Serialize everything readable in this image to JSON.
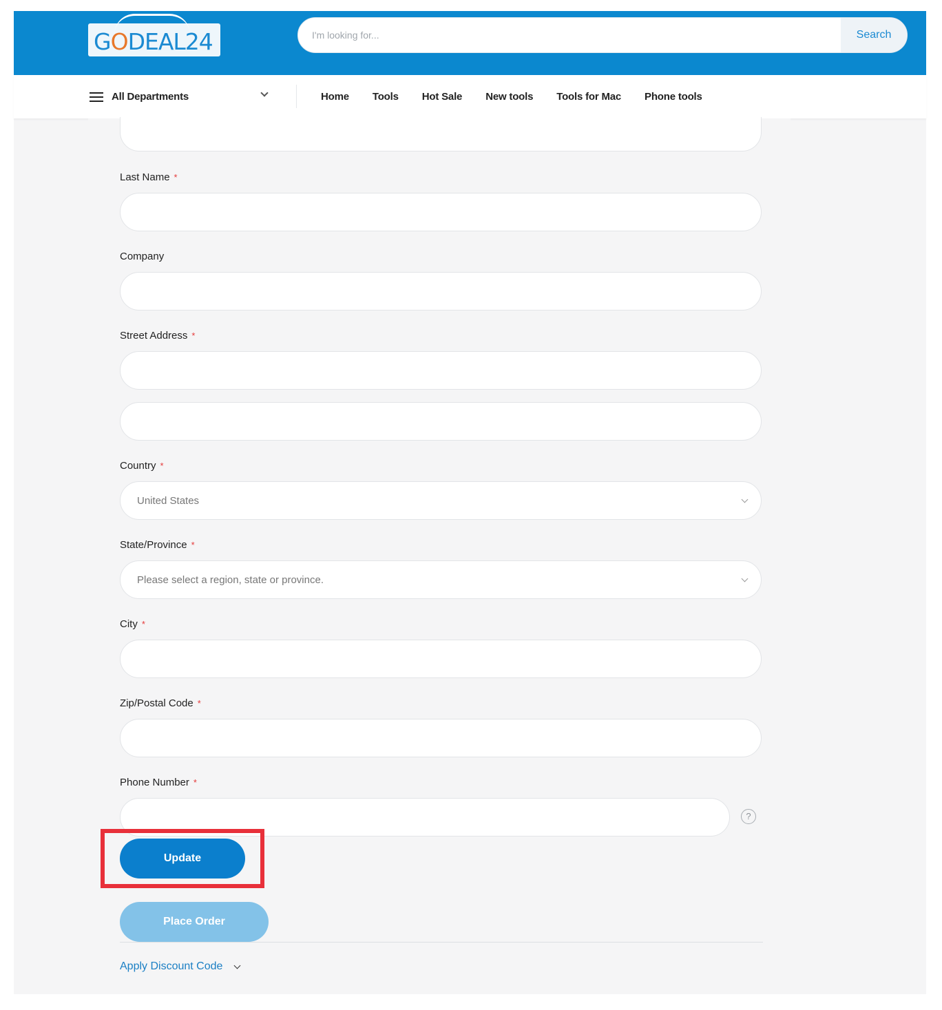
{
  "header": {
    "logo": {
      "prefix": "G",
      "o": "O",
      "suffix": "DEAL24"
    },
    "search": {
      "placeholder": "I'm looking for...",
      "button_label": "Search"
    }
  },
  "nav": {
    "departments_label": "All Departments",
    "links": [
      "Home",
      "Tools",
      "Hot Sale",
      "New tools",
      "Tools for Mac",
      "Phone tools"
    ]
  },
  "form": {
    "first_name_value": "",
    "last_name": {
      "label": "Last Name",
      "required": "*",
      "value": ""
    },
    "company": {
      "label": "Company",
      "value": ""
    },
    "street": {
      "label": "Street Address",
      "required": "*",
      "line1": "",
      "line2": ""
    },
    "country": {
      "label": "Country",
      "required": "*",
      "selected": "United States"
    },
    "state": {
      "label": "State/Province",
      "required": "*",
      "selected": "Please select a region, state or province."
    },
    "city": {
      "label": "City",
      "required": "*",
      "value": ""
    },
    "zip": {
      "label": "Zip/Postal Code",
      "required": "*",
      "value": ""
    },
    "phone": {
      "label": "Phone Number",
      "required": "*",
      "value": "",
      "help": "?"
    }
  },
  "actions": {
    "update_label": "Update",
    "place_order_label": "Place Order",
    "discount_label": "Apply Discount Code"
  },
  "colors": {
    "header_blue": "#0b88cf",
    "primary_button": "#0b7fcd",
    "disabled_button": "#83c2e8",
    "required_star": "#e53b3b",
    "highlight_box": "#e8303a",
    "link": "#1b7fc4"
  }
}
